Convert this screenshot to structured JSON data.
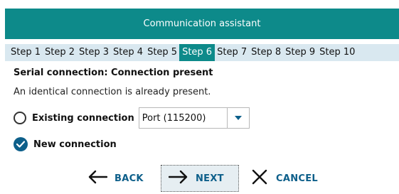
{
  "window": {
    "title": "Communication assistant"
  },
  "steps": [
    {
      "label": "Step 1",
      "active": false
    },
    {
      "label": "Step 2",
      "active": false
    },
    {
      "label": "Step 3",
      "active": false
    },
    {
      "label": "Step 4",
      "active": false
    },
    {
      "label": "Step 5",
      "active": false
    },
    {
      "label": "Step 6",
      "active": true
    },
    {
      "label": "Step 7",
      "active": false
    },
    {
      "label": "Step 8",
      "active": false
    },
    {
      "label": "Step 9",
      "active": false
    },
    {
      "label": "Step 10",
      "active": false
    }
  ],
  "content": {
    "heading": "Serial connection: Connection present",
    "description": "An identical connection is already present."
  },
  "options": {
    "existing": {
      "label": "Existing connection",
      "checked": false,
      "select_value": "Port (115200)"
    },
    "new": {
      "label": "New connection",
      "checked": true
    }
  },
  "buttons": {
    "back": "BACK",
    "next": "NEXT",
    "cancel": "CANCEL"
  },
  "colors": {
    "accent": "#0d8a8a",
    "button_text": "#0d5f8a",
    "steps_bar": "#d9e8f0"
  },
  "icons": {
    "back": "arrow-left-icon",
    "next": "arrow-right-icon",
    "cancel": "close-icon",
    "dropdown": "caret-down-icon",
    "checked": "checkmark-icon"
  }
}
